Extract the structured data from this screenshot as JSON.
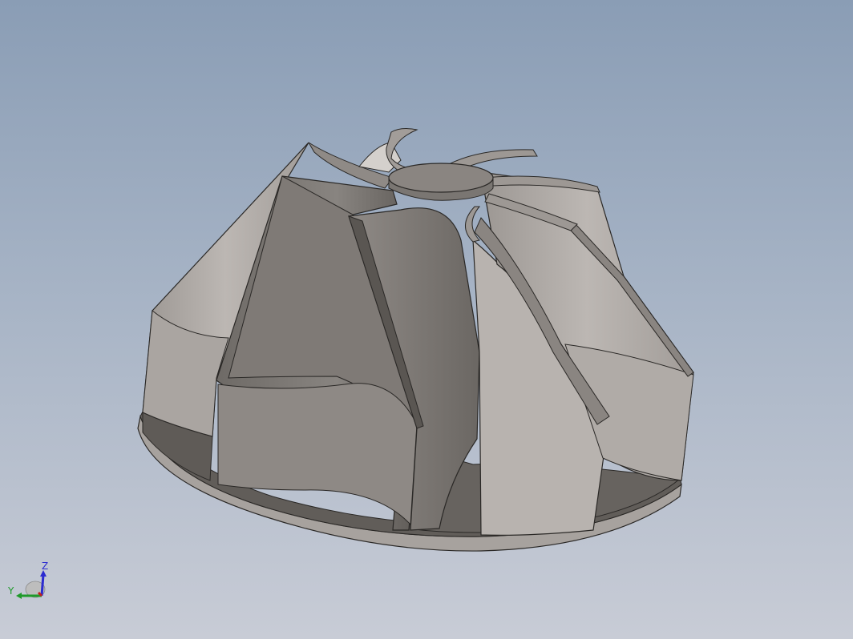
{
  "viewport": {
    "background_top": "#8a9db5",
    "background_bottom": "#c8ccd6"
  },
  "model": {
    "part": "impeller",
    "blade_count": 8,
    "face_color_light": "#b3aeaa",
    "face_color_mid": "#8d8884",
    "face_color_dark": "#605c58",
    "edge_color": "#2a2826"
  },
  "triad": {
    "z_label": "Z",
    "y_label": "Y",
    "x_label": "",
    "z_color": "#2b2bd0",
    "y_color": "#1f9a2a",
    "x_color": "#c02020"
  }
}
